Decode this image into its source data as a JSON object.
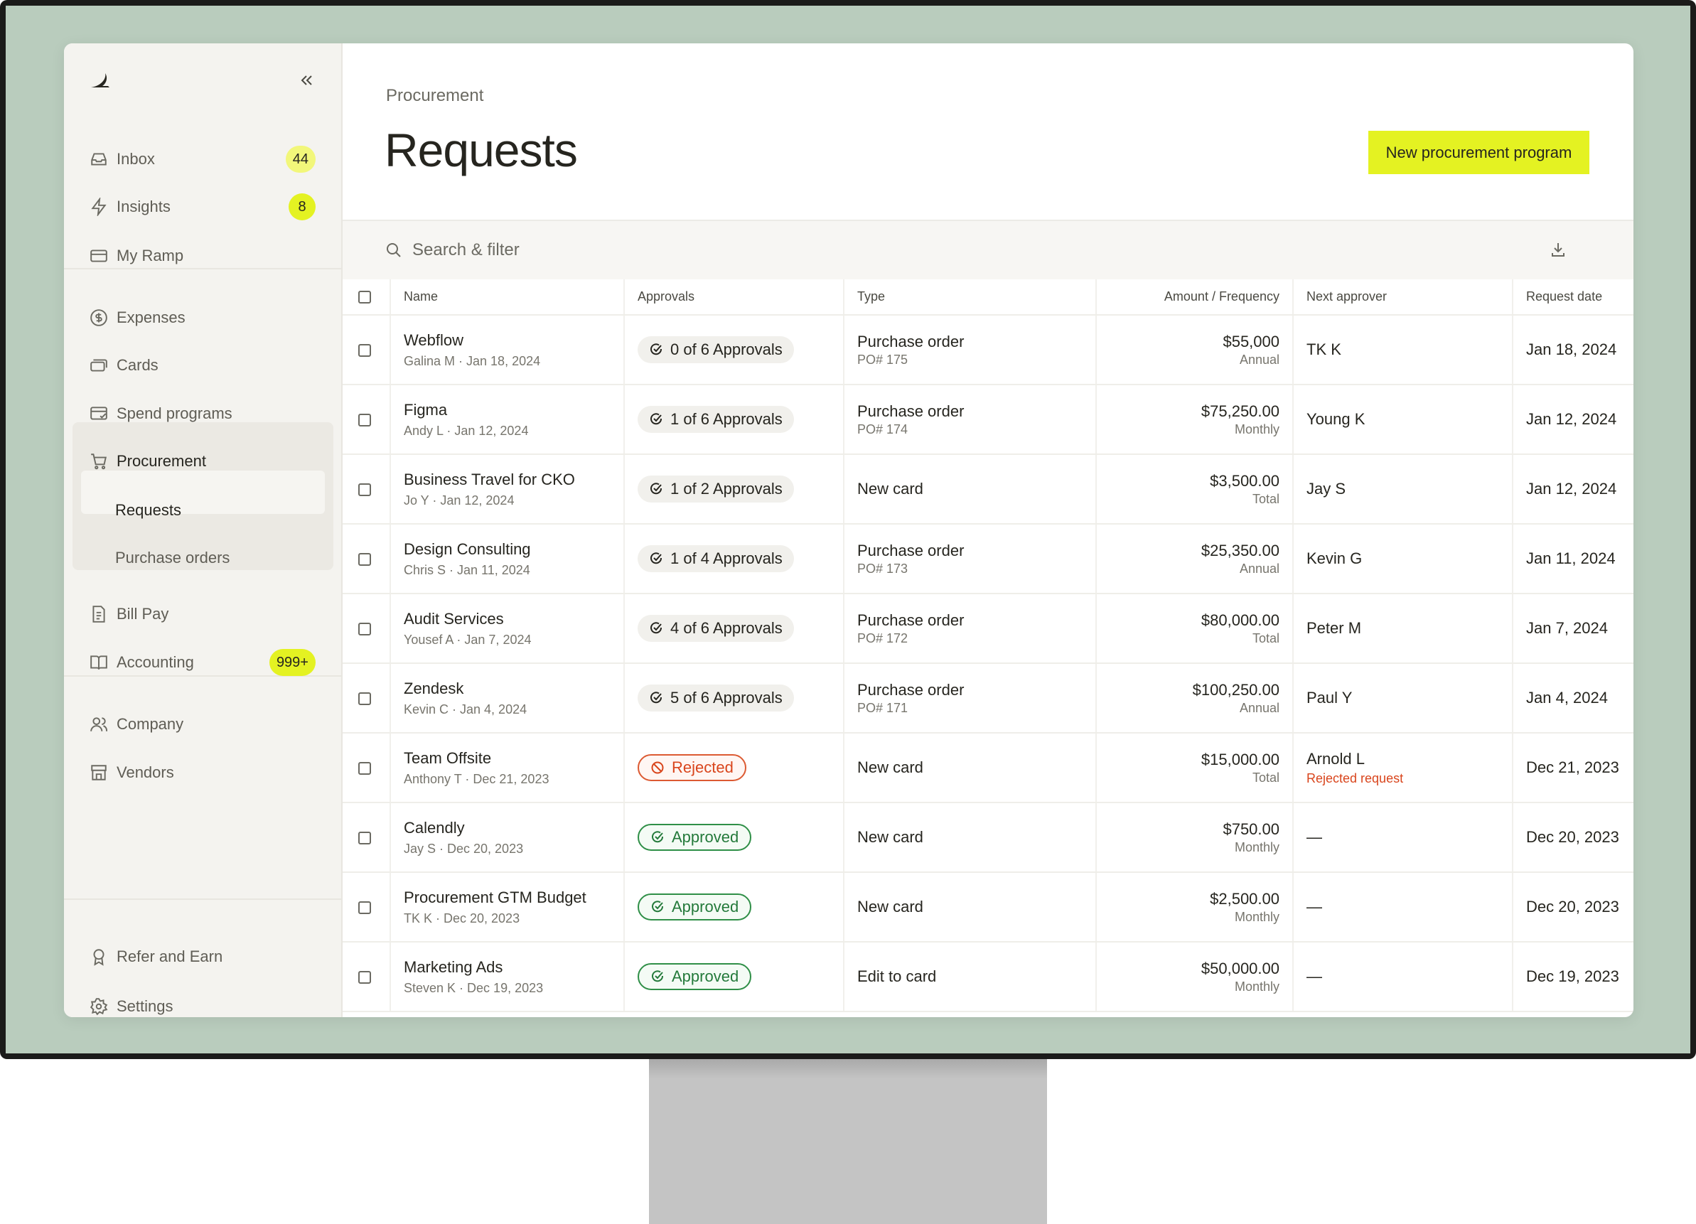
{
  "sidebar": {
    "items": [
      {
        "label": "Inbox",
        "icon": "inbox-icon",
        "badge": "44"
      },
      {
        "label": "Insights",
        "icon": "lightning-icon",
        "badge": "8"
      },
      {
        "label": "My Ramp",
        "icon": "card-icon"
      },
      {
        "label": "Expenses",
        "icon": "dollar-circle-icon"
      },
      {
        "label": "Cards",
        "icon": "cards-icon"
      },
      {
        "label": "Spend programs",
        "icon": "spend-programs-icon"
      },
      {
        "label": "Procurement",
        "icon": "cart-icon"
      },
      {
        "label": "Requests"
      },
      {
        "label": "Purchase orders"
      },
      {
        "label": "Bill Pay",
        "icon": "bill-icon"
      },
      {
        "label": "Accounting",
        "icon": "book-icon",
        "badge": "999+"
      },
      {
        "label": "Company",
        "icon": "people-icon"
      },
      {
        "label": "Vendors",
        "icon": "store-icon"
      },
      {
        "label": "Refer and Earn",
        "icon": "award-icon"
      },
      {
        "label": "Settings",
        "icon": "gear-icon"
      }
    ]
  },
  "header": {
    "breadcrumb": "Procurement",
    "title": "Requests",
    "new_button": "New procurement program"
  },
  "search": {
    "placeholder": "Search & filter"
  },
  "colors": {
    "accent": "#e4f222",
    "rejected": "#d9451c",
    "approved": "#247a3b"
  },
  "table": {
    "columns": [
      "Name",
      "Approvals",
      "Type",
      "Amount / Frequency",
      "Next approver",
      "Request date"
    ],
    "rows": [
      {
        "name": "Webflow",
        "meta": "Galina M · Jan 18, 2024",
        "approval": "0 of 6 Approvals",
        "status": "pending",
        "type": "Purchase order",
        "po": "PO# 175",
        "amount": "$55,000",
        "freq": "Annual",
        "approver": "TK K",
        "date": "Jan 18, 2024"
      },
      {
        "name": "Figma",
        "meta": "Andy L · Jan 12, 2024",
        "approval": "1 of 6 Approvals",
        "status": "pending",
        "type": "Purchase order",
        "po": "PO# 174",
        "amount": "$75,250.00",
        "freq": "Monthly",
        "approver": "Young K",
        "date": "Jan 12, 2024"
      },
      {
        "name": "Business Travel for CKO",
        "meta": "Jo Y · Jan 12, 2024",
        "approval": "1 of 2 Approvals",
        "status": "pending",
        "type": "New card",
        "amount": "$3,500.00",
        "freq": "Total",
        "approver": "Jay S",
        "date": "Jan 12, 2024"
      },
      {
        "name": "Design Consulting",
        "meta": "Chris S · Jan 11, 2024",
        "approval": "1 of 4 Approvals",
        "status": "pending",
        "type": "Purchase order",
        "po": "PO# 173",
        "amount": "$25,350.00",
        "freq": "Annual",
        "approver": "Kevin G",
        "date": "Jan 11, 2024"
      },
      {
        "name": "Audit Services",
        "meta": "Yousef A · Jan 7, 2024",
        "approval": "4 of 6 Approvals",
        "status": "pending",
        "type": "Purchase order",
        "po": "PO# 172",
        "amount": "$80,000.00",
        "freq": "Total",
        "approver": "Peter M",
        "date": "Jan 7, 2024"
      },
      {
        "name": "Zendesk",
        "meta": "Kevin C · Jan 4, 2024",
        "approval": "5 of 6 Approvals",
        "status": "pending",
        "type": "Purchase order",
        "po": "PO# 171",
        "amount": "$100,250.00",
        "freq": "Annual",
        "approver": "Paul Y",
        "date": "Jan 4, 2024"
      },
      {
        "name": "Team Offsite",
        "meta": "Anthony T · Dec 21, 2023",
        "approval": "Rejected",
        "status": "rejected",
        "type": "New card",
        "amount": "$15,000.00",
        "freq": "Total",
        "approver": "Arnold L",
        "approver_note": "Rejected request",
        "date": "Dec 21, 2023"
      },
      {
        "name": "Calendly",
        "meta": "Jay S · Dec 20, 2023",
        "approval": "Approved",
        "status": "approved",
        "type": "New card",
        "amount": "$750.00",
        "freq": "Monthly",
        "approver": "—",
        "date": "Dec 20, 2023"
      },
      {
        "name": "Procurement GTM Budget",
        "meta": "TK K · Dec 20, 2023",
        "approval": "Approved",
        "status": "approved",
        "type": "New card",
        "amount": "$2,500.00",
        "freq": "Monthly",
        "approver": "—",
        "date": "Dec 20, 2023"
      },
      {
        "name": "Marketing Ads",
        "meta": "Steven K · Dec 19, 2023",
        "approval": "Approved",
        "status": "approved",
        "type": "Edit to card",
        "amount": "$50,000.00",
        "freq": "Monthly",
        "approver": "—",
        "date": "Dec 19, 2023"
      }
    ]
  }
}
